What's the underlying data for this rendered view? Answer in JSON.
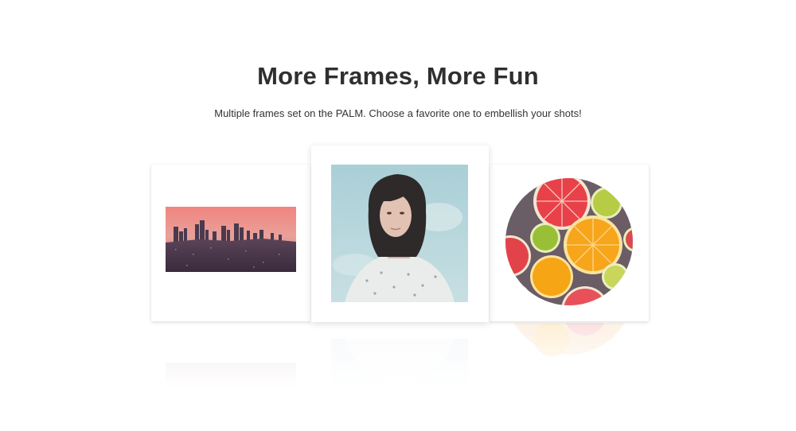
{
  "section": {
    "title": "More Frames, More Fun",
    "subtitle": "Multiple frames set on the PALM. Choose a favorite one to embellish your shots!"
  },
  "frames": [
    {
      "image": "city-skyline-photo"
    },
    {
      "image": "woman-portrait-photo"
    },
    {
      "image": "citrus-slices-photo"
    }
  ]
}
